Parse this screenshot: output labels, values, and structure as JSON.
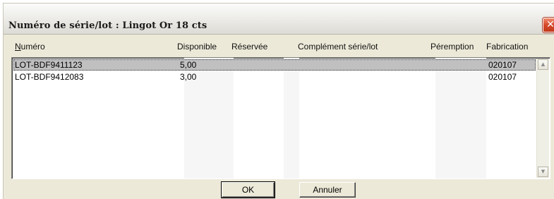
{
  "window": {
    "title": "Numéro de série/lot : Lingot Or 18 cts",
    "close_glyph": "✕",
    "close_icon": "close-icon"
  },
  "columns": [
    {
      "key": "numero",
      "label_prefix": "",
      "label_underlined": "N",
      "label_rest": "uméro"
    },
    {
      "key": "disponible",
      "label": "Disponible"
    },
    {
      "key": "reservee",
      "label": "Réservée"
    },
    {
      "key": "complement",
      "label": "Complément série/lot"
    },
    {
      "key": "peremption",
      "label": "Péremption"
    },
    {
      "key": "fabrication",
      "label": "Fabrication"
    }
  ],
  "rows": [
    {
      "numero": "LOT-BDF9411123",
      "disponible": "5,00",
      "reservee": "",
      "complement": "",
      "peremption": "",
      "fabrication": "020107",
      "selected": true
    },
    {
      "numero": "LOT-BDF9412083",
      "disponible": "3,00",
      "reservee": "",
      "complement": "",
      "peremption": "",
      "fabrication": "020107",
      "selected": false
    }
  ],
  "scrollbar": {
    "up_glyph": "▲",
    "down_glyph": "▼"
  },
  "buttons": {
    "ok": "OK",
    "cancel": "Annuler"
  }
}
